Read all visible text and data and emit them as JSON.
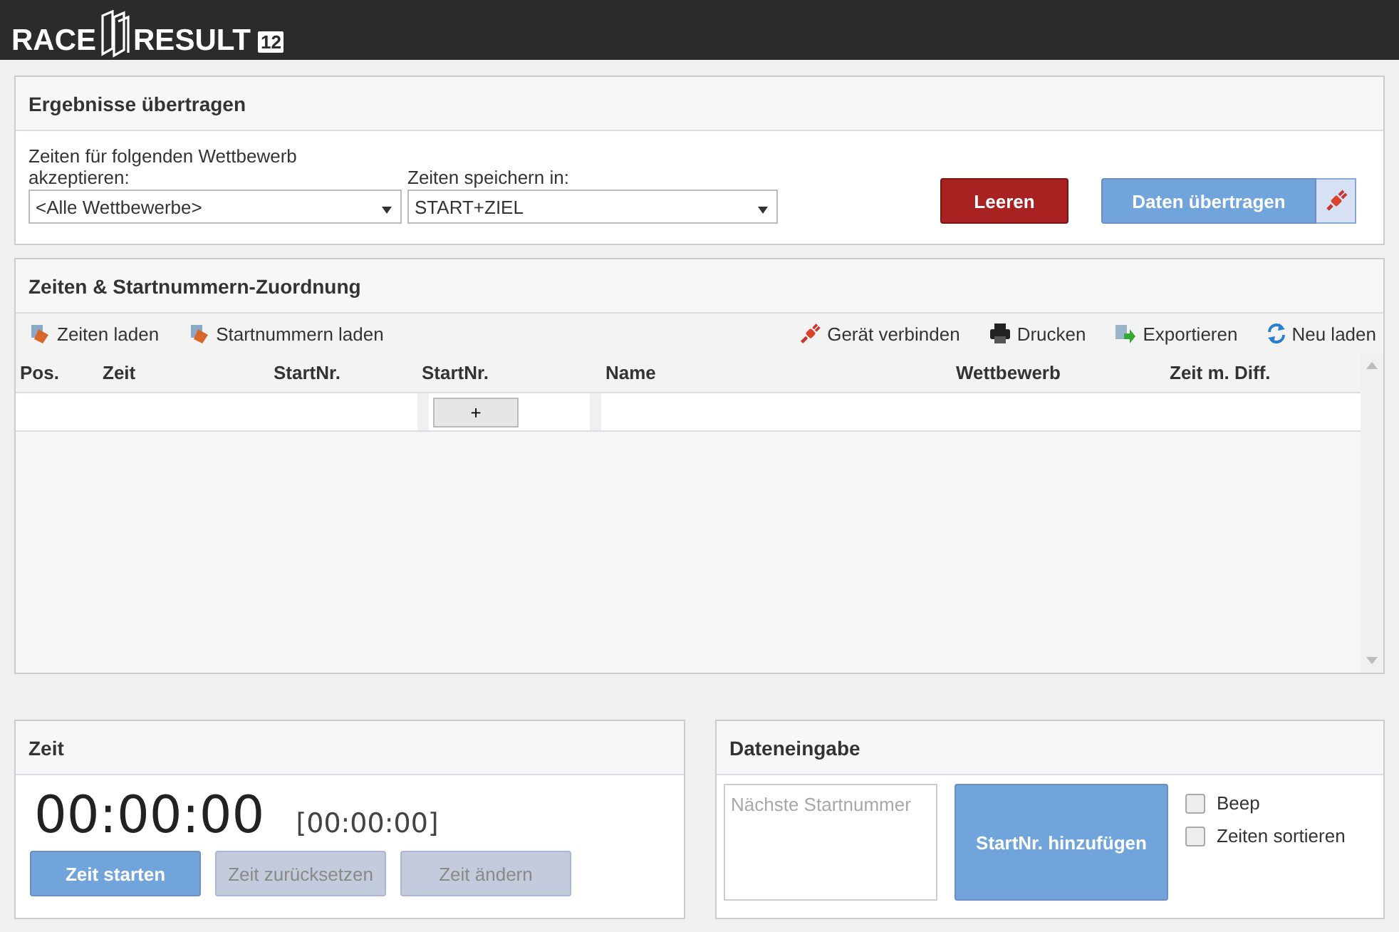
{
  "header": {
    "logo": {
      "left": "RACE",
      "right": "RESULT",
      "badge": "12"
    }
  },
  "transfer": {
    "title": "Ergebnisse übertragen",
    "fields": [
      {
        "label": "Zeiten für folgenden Wettbewerb akzeptieren:",
        "value": "<Alle Wettbewerbe>"
      },
      {
        "label": "Zeiten speichern in:",
        "value": "START+ZIEL"
      }
    ],
    "clear_button": "Leeren",
    "transfer_button": "Daten übertragen"
  },
  "assignment": {
    "title": "Zeiten & Startnummern-Zuordnung",
    "toolbar_left": [
      {
        "label": "Zeiten laden",
        "kind": "load"
      },
      {
        "label": "Startnummern laden",
        "kind": "load"
      }
    ],
    "toolbar_right": [
      {
        "label": "Gerät verbinden",
        "kind": "plug"
      },
      {
        "label": "Drucken",
        "kind": "print"
      },
      {
        "label": "Exportieren",
        "kind": "export"
      },
      {
        "label": "Neu laden",
        "kind": "reload"
      }
    ],
    "table": {
      "columns": [
        "Pos.",
        "Zeit",
        "StartNr.",
        "StartNr.",
        "Name",
        "Wettbewerb",
        "Zeit m. Diff."
      ],
      "rows": [
        {
          "add_button": "+"
        }
      ]
    }
  },
  "time": {
    "title": "Zeit",
    "clock": "00:00:00",
    "reference": "[00:00:00]",
    "buttons": [
      {
        "label": "Zeit starten",
        "disabled": false
      },
      {
        "label": "Zeit zurücksetzen",
        "disabled": true
      },
      {
        "label": "Zeit ändern",
        "disabled": true
      }
    ]
  },
  "data_entry": {
    "title": "Dateneingabe",
    "input": {
      "placeholder": "Nächste Startnummer"
    },
    "add_button": "StartNr. hinzufügen",
    "options": [
      {
        "label": "Beep",
        "checked": false
      },
      {
        "label": "Zeiten sortieren",
        "checked": false
      }
    ]
  }
}
